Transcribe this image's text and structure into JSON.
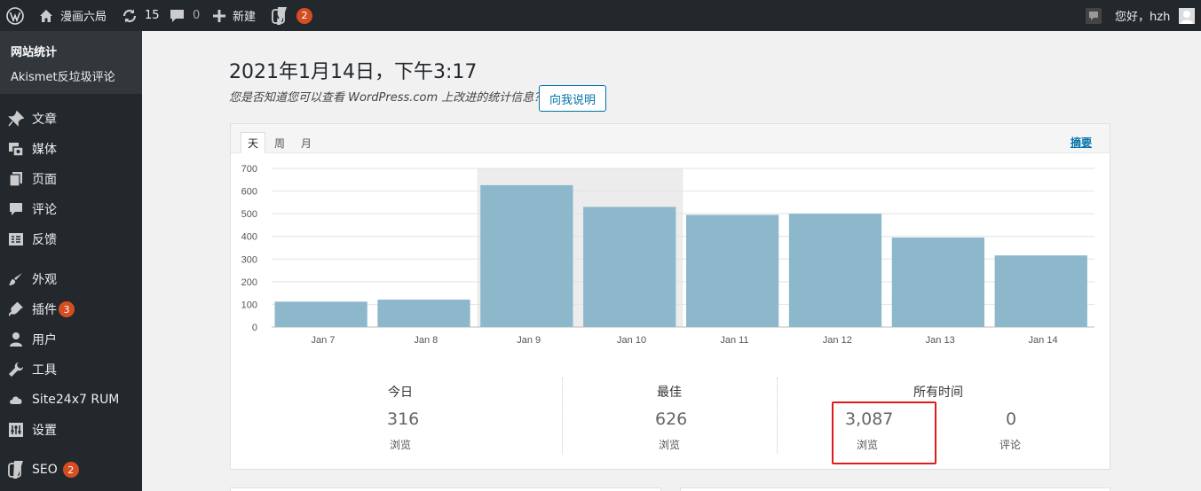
{
  "adminbar": {
    "site_name": "漫画六局",
    "updates_count": "15",
    "comments_count": "0",
    "new_label": "新建",
    "seo_badge": "2",
    "greeting": "您好，hzh"
  },
  "sidebar": {
    "submenu": [
      {
        "label": "网站统计"
      },
      {
        "label": "Akismet反垃圾评论"
      }
    ],
    "items": [
      {
        "label": "文章",
        "icon": "pin-icon"
      },
      {
        "label": "媒体",
        "icon": "media-icon"
      },
      {
        "label": "页面",
        "icon": "page-icon"
      },
      {
        "label": "评论",
        "icon": "comment-icon"
      },
      {
        "label": "反馈",
        "icon": "feedback-icon"
      },
      {
        "label": "外观",
        "icon": "brush-icon"
      },
      {
        "label": "插件",
        "icon": "plugin-icon",
        "badge": "3"
      },
      {
        "label": "用户",
        "icon": "user-icon"
      },
      {
        "label": "工具",
        "icon": "wrench-icon"
      },
      {
        "label": "Site24x7 RUM",
        "icon": "cloud-icon"
      },
      {
        "label": "设置",
        "icon": "settings-icon"
      },
      {
        "label": "SEO",
        "icon": "yoast-icon",
        "badge": "2"
      }
    ]
  },
  "main": {
    "date_title": "2021年1月14日，下午3:17",
    "promo_text": "您是否知道您可以查看 WordPress.com 上改进的统计信息？",
    "tellme_label": "向我说明",
    "tabs": [
      {
        "label": "天"
      },
      {
        "label": "周"
      },
      {
        "label": "月"
      }
    ],
    "summary_link": "摘要"
  },
  "chart_data": {
    "type": "bar",
    "categories": [
      "Jan 7",
      "Jan 8",
      "Jan 9",
      "Jan 10",
      "Jan 11",
      "Jan 12",
      "Jan 13",
      "Jan 14"
    ],
    "values": [
      112,
      121,
      626,
      530,
      495,
      500,
      395,
      316
    ],
    "ylim": [
      0,
      700
    ],
    "yticks": [
      0,
      100,
      200,
      300,
      400,
      500,
      600,
      700
    ],
    "highlighted": [
      "Jan 9",
      "Jan 10"
    ],
    "bar_color": "#8db8cc",
    "highlight_color": "#ececec",
    "grid": true
  },
  "summary": {
    "today": {
      "title": "今日",
      "value": "316",
      "label": "浏览"
    },
    "best": {
      "title": "最佳",
      "value": "626",
      "label": "浏览"
    },
    "alltime": {
      "title": "所有时间",
      "views_value": "3,087",
      "views_label": "浏览",
      "comments_value": "0",
      "comments_label": "评论"
    }
  }
}
